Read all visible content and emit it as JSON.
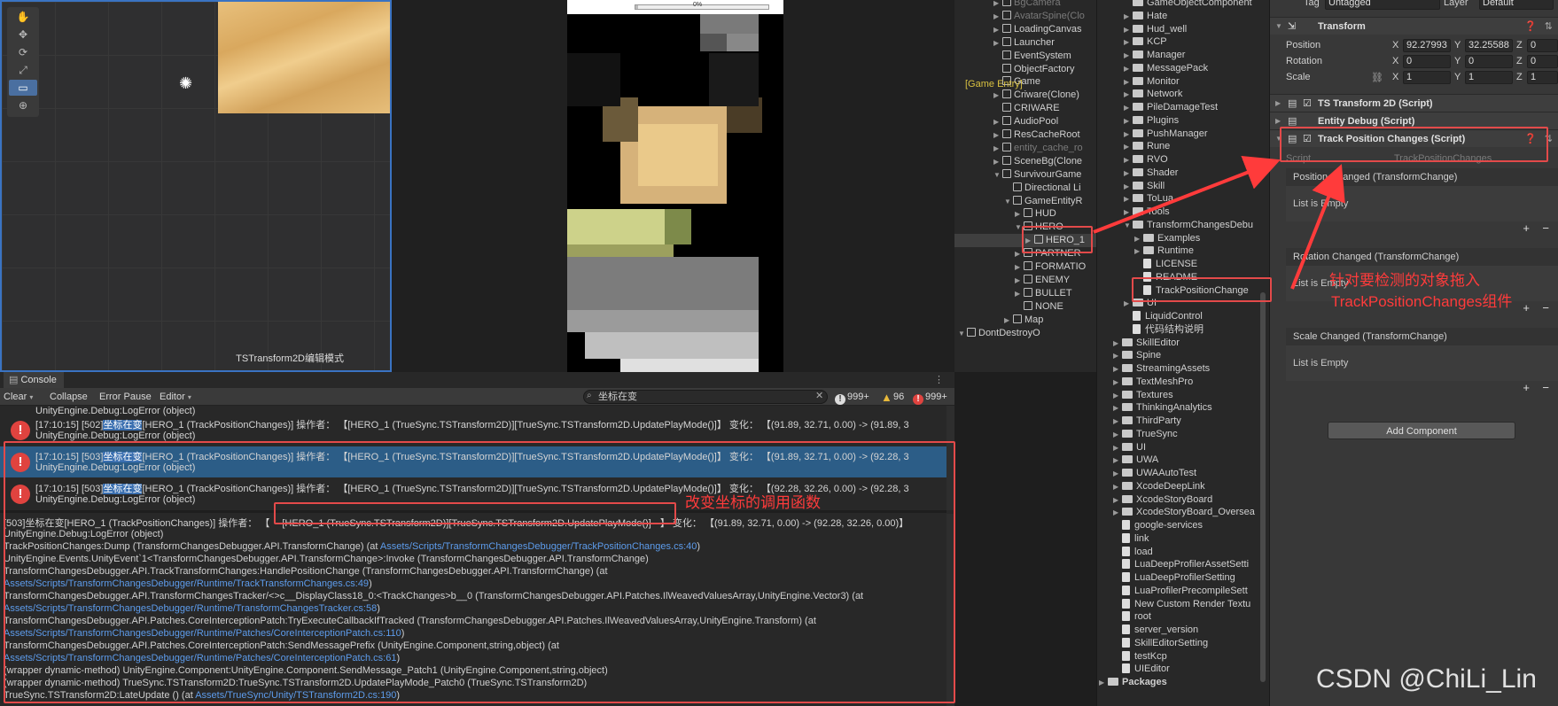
{
  "scene": {
    "mode_label": "TSTransform2D编辑模式",
    "tools": [
      "hand-tool",
      "move-tool",
      "rotate-tool",
      "scale-tool",
      "rect-tool",
      "transform-tool"
    ]
  },
  "game": {
    "progress_text": "0%"
  },
  "hierarchy": {
    "annotation_label": "[Game Entry]",
    "rows": [
      {
        "label": "BgCamera",
        "indent": 0,
        "arrow": "▶",
        "dim": true
      },
      {
        "label": "AvatarSpine(Clo",
        "indent": 0,
        "arrow": "▶",
        "dim": true
      },
      {
        "label": "LoadingCanvas",
        "indent": 0,
        "arrow": "▶"
      },
      {
        "label": "Launcher",
        "indent": 0,
        "arrow": "▶"
      },
      {
        "label": "EventSystem",
        "indent": 0,
        "arrow": ""
      },
      {
        "label": "ObjectFactory",
        "indent": 0,
        "arrow": ""
      },
      {
        "label": "Game",
        "indent": 0,
        "arrow": ""
      },
      {
        "label": "Criware(Clone)",
        "indent": 0,
        "arrow": "▶"
      },
      {
        "label": "CRIWARE",
        "indent": 0,
        "arrow": ""
      },
      {
        "label": "AudioPool",
        "indent": 0,
        "arrow": "▶"
      },
      {
        "label": "ResCacheRoot",
        "indent": 0,
        "arrow": "▶"
      },
      {
        "label": "entity_cache_ro",
        "indent": 0,
        "arrow": "▶",
        "dim": true
      },
      {
        "label": "SceneBg(Clone",
        "indent": 0,
        "arrow": "▶"
      },
      {
        "label": "SurvivourGame",
        "indent": 0,
        "arrow": "▼"
      },
      {
        "label": "Directional Li",
        "indent": 1,
        "arrow": ""
      },
      {
        "label": "GameEntityR",
        "indent": 1,
        "arrow": "▼"
      },
      {
        "label": "HUD",
        "indent": 2,
        "arrow": "▶"
      },
      {
        "label": "HERO",
        "indent": 2,
        "arrow": "▼"
      },
      {
        "label": "HERO_1",
        "indent": 3,
        "arrow": "▶",
        "selected": true
      },
      {
        "label": "PARTNER",
        "indent": 2,
        "arrow": "▶"
      },
      {
        "label": "FORMATIO",
        "indent": 2,
        "arrow": "▶"
      },
      {
        "label": "ENEMY",
        "indent": 2,
        "arrow": "▶"
      },
      {
        "label": "BULLET",
        "indent": 2,
        "arrow": "▶"
      },
      {
        "label": "NONE",
        "indent": 2,
        "arrow": ""
      },
      {
        "label": "Map",
        "indent": 1,
        "arrow": "▶"
      },
      {
        "label": "DontDestroyO",
        "indent": -1,
        "arrow": "▼"
      }
    ]
  },
  "project": {
    "rows": [
      {
        "label": "GameObjectComponent",
        "indent": 1,
        "type": "folder"
      },
      {
        "label": "Hate",
        "indent": 1,
        "type": "folder",
        "arrow": "▶"
      },
      {
        "label": "Hud_well",
        "indent": 1,
        "type": "folder",
        "arrow": "▶"
      },
      {
        "label": "KCP",
        "indent": 1,
        "type": "folder",
        "arrow": "▶"
      },
      {
        "label": "Manager",
        "indent": 1,
        "type": "folder",
        "arrow": "▶"
      },
      {
        "label": "MessagePack",
        "indent": 1,
        "type": "folder",
        "arrow": "▶"
      },
      {
        "label": "Monitor",
        "indent": 1,
        "type": "folder",
        "arrow": "▶"
      },
      {
        "label": "Network",
        "indent": 1,
        "type": "folder",
        "arrow": "▶"
      },
      {
        "label": "PileDamageTest",
        "indent": 1,
        "type": "folder",
        "arrow": "▶"
      },
      {
        "label": "Plugins",
        "indent": 1,
        "type": "folder",
        "arrow": "▶"
      },
      {
        "label": "PushManager",
        "indent": 1,
        "type": "folder",
        "arrow": "▶"
      },
      {
        "label": "Rune",
        "indent": 1,
        "type": "folder",
        "arrow": "▶"
      },
      {
        "label": "RVO",
        "indent": 1,
        "type": "folder",
        "arrow": "▶"
      },
      {
        "label": "Shader",
        "indent": 1,
        "type": "folder",
        "arrow": "▶"
      },
      {
        "label": "Skill",
        "indent": 1,
        "type": "folder",
        "arrow": "▶"
      },
      {
        "label": "ToLua",
        "indent": 1,
        "type": "folder",
        "arrow": "▶"
      },
      {
        "label": "Tools",
        "indent": 1,
        "type": "folder",
        "arrow": "▶"
      },
      {
        "label": "TransformChangesDebu",
        "indent": 1,
        "type": "folder",
        "arrow": "▼"
      },
      {
        "label": "Examples",
        "indent": 2,
        "type": "folder",
        "arrow": "▶"
      },
      {
        "label": "Runtime",
        "indent": 2,
        "type": "folder",
        "arrow": "▶"
      },
      {
        "label": "LICENSE",
        "indent": 2,
        "type": "file"
      },
      {
        "label": "README",
        "indent": 2,
        "type": "file"
      },
      {
        "label": "TrackPositionChange",
        "indent": 2,
        "type": "file"
      },
      {
        "label": "UI",
        "indent": 1,
        "type": "folder",
        "arrow": "▶"
      },
      {
        "label": "LiquidControl",
        "indent": 1,
        "type": "file"
      },
      {
        "label": "代码结构说明",
        "indent": 1,
        "type": "file"
      },
      {
        "label": "SkillEditor",
        "indent": 0,
        "type": "folder",
        "arrow": "▶"
      },
      {
        "label": "Spine",
        "indent": 0,
        "type": "folder",
        "arrow": "▶"
      },
      {
        "label": "StreamingAssets",
        "indent": 0,
        "type": "folder",
        "arrow": "▶"
      },
      {
        "label": "TextMeshPro",
        "indent": 0,
        "type": "folder",
        "arrow": "▶"
      },
      {
        "label": "Textures",
        "indent": 0,
        "type": "folder",
        "arrow": "▶"
      },
      {
        "label": "ThinkingAnalytics",
        "indent": 0,
        "type": "folder",
        "arrow": "▶"
      },
      {
        "label": "ThirdParty",
        "indent": 0,
        "type": "folder",
        "arrow": "▶"
      },
      {
        "label": "TrueSync",
        "indent": 0,
        "type": "folder",
        "arrow": "▶"
      },
      {
        "label": "UI",
        "indent": 0,
        "type": "folder",
        "arrow": "▶"
      },
      {
        "label": "UWA",
        "indent": 0,
        "type": "folder",
        "arrow": "▶"
      },
      {
        "label": "UWAAutoTest",
        "indent": 0,
        "type": "folder",
        "arrow": "▶"
      },
      {
        "label": "XcodeDeepLink",
        "indent": 0,
        "type": "folder",
        "arrow": "▶"
      },
      {
        "label": "XcodeStoryBoard",
        "indent": 0,
        "type": "folder",
        "arrow": "▶"
      },
      {
        "label": "XcodeStoryBoard_Oversea",
        "indent": 0,
        "type": "folder",
        "arrow": "▶"
      },
      {
        "label": "google-services",
        "indent": 0,
        "type": "file"
      },
      {
        "label": "link",
        "indent": 0,
        "type": "file"
      },
      {
        "label": "load",
        "indent": 0,
        "type": "file"
      },
      {
        "label": "LuaDeepProfilerAssetSetti",
        "indent": 0,
        "type": "file"
      },
      {
        "label": "LuaDeepProfilerSetting",
        "indent": 0,
        "type": "file"
      },
      {
        "label": "LuaProfilerPrecompileSett",
        "indent": 0,
        "type": "file"
      },
      {
        "label": "New Custom Render Textu",
        "indent": 0,
        "type": "file"
      },
      {
        "label": "root",
        "indent": 0,
        "type": "file"
      },
      {
        "label": "server_version",
        "indent": 0,
        "type": "file"
      },
      {
        "label": "SkillEditorSetting",
        "indent": 0,
        "type": "file"
      },
      {
        "label": "testKcp",
        "indent": 0,
        "type": "file"
      },
      {
        "label": "UIEditor",
        "indent": 0,
        "type": "file"
      },
      {
        "label": "Packages",
        "indent": -1,
        "type": "folder",
        "arrow": "▶",
        "bold": true
      }
    ]
  },
  "inspector": {
    "tag_label": "Tag",
    "tag_value": "Untagged",
    "layer_label": "Layer",
    "layer_value": "Default",
    "transform_title": "Transform",
    "position_label": "Position",
    "rotation_label": "Rotation",
    "scale_label": "Scale",
    "pos_x": "92.27993",
    "pos_y": "32.25588",
    "pos_z": "0",
    "rot_x": "0",
    "rot_y": "0",
    "rot_z": "0",
    "scale_x": "1",
    "scale_y": "1",
    "scale_z": "1",
    "comp1": "TS Transform 2D (Script)",
    "comp2": "Entity Debug (Script)",
    "comp3": "Track Position Changes (Script)",
    "script_label": "Script",
    "script_value": "TrackPositionChanges",
    "events": [
      {
        "title": "Position Changed (TransformChange)",
        "body": "List is Empty"
      },
      {
        "title": "Rotation Changed (TransformChange)",
        "body": "List is Empty"
      },
      {
        "title": "Scale Changed (TransformChange)",
        "body": "List is Empty"
      }
    ],
    "add_component": "Add Component"
  },
  "console": {
    "tab": "Console",
    "clear": "Clear",
    "collapse": "Collapse",
    "error_pause": "Error Pause",
    "editor": "Editor",
    "search_value": "坐标在变",
    "info_count": "999+",
    "warn_count": "96",
    "error_count": "999+",
    "top_partial": "UnityEngine.Debug:LogError (object)",
    "logs": [
      {
        "l1a": "[17:10:15] [502]",
        "hl": "坐标在变",
        "l1b": "[HERO_1 (TrackPositionChanges)] 操作者： 【[HERO_1 (TrueSync.TSTransform2D)][TrueSync.TSTransform2D.UpdatePlayMode()]】 变化： 【(91.89, 32.71, 0.00) -> (91.89, 3",
        "l2": "UnityEngine.Debug:LogError (object)"
      },
      {
        "l1a": "[17:10:15] [503]",
        "hl": "坐标在变",
        "l1b": "[HERO_1 (TrackPositionChanges)] 操作者： 【[HERO_1 (TrueSync.TSTransform2D)][TrueSync.TSTransform2D.UpdatePlayMode()]】 变化： 【(91.89, 32.71, 0.00) -> (92.28, 3",
        "l2": "UnityEngine.Debug:LogError (object)",
        "selected": true
      },
      {
        "l1a": "[17:10:15] [503]",
        "hl": "坐标在变",
        "l1b": "[HERO_1 (TrackPositionChanges)] 操作者： 【[HERO_1 (TrueSync.TSTransform2D)][TrueSync.TSTransform2D.UpdatePlayMode()]】 变化： 【(92.28, 32.26, 0.00) -> (92.28, 3",
        "l2": "UnityEngine.Debug:LogError (object)"
      }
    ],
    "stack_head_a": "[503]坐标在变[HERO_1 (TrackPositionChanges)] 操作者： 【",
    "stack_head_b": "[HERO_1 (TrueSync.TSTransform2D)][TrueSync.TSTransform2D.UpdatePlayMode()]",
    "stack_head_c": "】 变化： 【(91.89, 32.71, 0.00) -> (92.28, 32.26, 0.00)】",
    "stack": [
      {
        "text": "UnityEngine.Debug:LogError (object)"
      },
      {
        "text": "TrackPositionChanges:Dump (TransformChangesDebugger.API.TransformChange) (at ",
        "link": "Assets/Scripts/TransformChangesDebugger/TrackPositionChanges.cs:40",
        "after": ")"
      },
      {
        "text": "UnityEngine.Events.UnityEvent`1<TransformChangesDebugger.API.TransformChange>:Invoke (TransformChangesDebugger.API.TransformChange)"
      },
      {
        "text": "TransformChangesDebugger.API.TrackTransformChanges:HandlePositionChange (TransformChangesDebugger.API.TransformChange) (at"
      },
      {
        "text": "",
        "link": "Assets/Scripts/TransformChangesDebugger/Runtime/TrackTransformChanges.cs:49",
        "after": ")"
      },
      {
        "text": "TransformChangesDebugger.API.TransformChangesTracker/<>c__DisplayClass18_0:<TrackChanges>b__0 (TransformChangesDebugger.API.Patches.IlWeavedValuesArray,UnityEngine.Vector3) (at"
      },
      {
        "text": "",
        "link": "Assets/Scripts/TransformChangesDebugger/Runtime/TransformChangesTracker.cs:58",
        "after": ")"
      },
      {
        "text": "TransformChangesDebugger.API.Patches.CoreInterceptionPatch:TryExecuteCallbackIfTracked (TransformChangesDebugger.API.Patches.IlWeavedValuesArray,UnityEngine.Transform) (at"
      },
      {
        "text": "",
        "link": "Assets/Scripts/TransformChangesDebugger/Runtime/Patches/CoreInterceptionPatch.cs:110",
        "after": ")"
      },
      {
        "text": "TransformChangesDebugger.API.Patches.CoreInterceptionPatch:SendMessagePrefix (UnityEngine.Component,string,object) (at"
      },
      {
        "text": "",
        "link": "Assets/Scripts/TransformChangesDebugger/Runtime/Patches/CoreInterceptionPatch.cs:61",
        "after": ")"
      },
      {
        "text": "(wrapper dynamic-method) UnityEngine.Component:UnityEngine.Component.SendMessage_Patch1 (UnityEngine.Component,string,object)"
      },
      {
        "text": "(wrapper dynamic-method) TrueSync.TSTransform2D:TrueSync.TSTransform2D.UpdatePlayMode_Patch0 (TrueSync.TSTransform2D)"
      },
      {
        "text": "TrueSync.TSTransform2D:LateUpdate () (at ",
        "link": "Assets/TrueSync/Unity/TSTransform2D.cs:190",
        "after": ")"
      }
    ]
  },
  "annotations": {
    "call_function": "改变坐标的调用函数",
    "drag_note_1": "针对要检测的对象拖入",
    "drag_note_2": "TrackPositionChanges组件"
  },
  "watermark": "CSDN @ChiLi_Lin",
  "colors": {
    "annotation_red": "#e34a4a",
    "selection_blue": "#2c5d87",
    "link_blue": "#5d9cec",
    "error_red": "#e0433f"
  }
}
